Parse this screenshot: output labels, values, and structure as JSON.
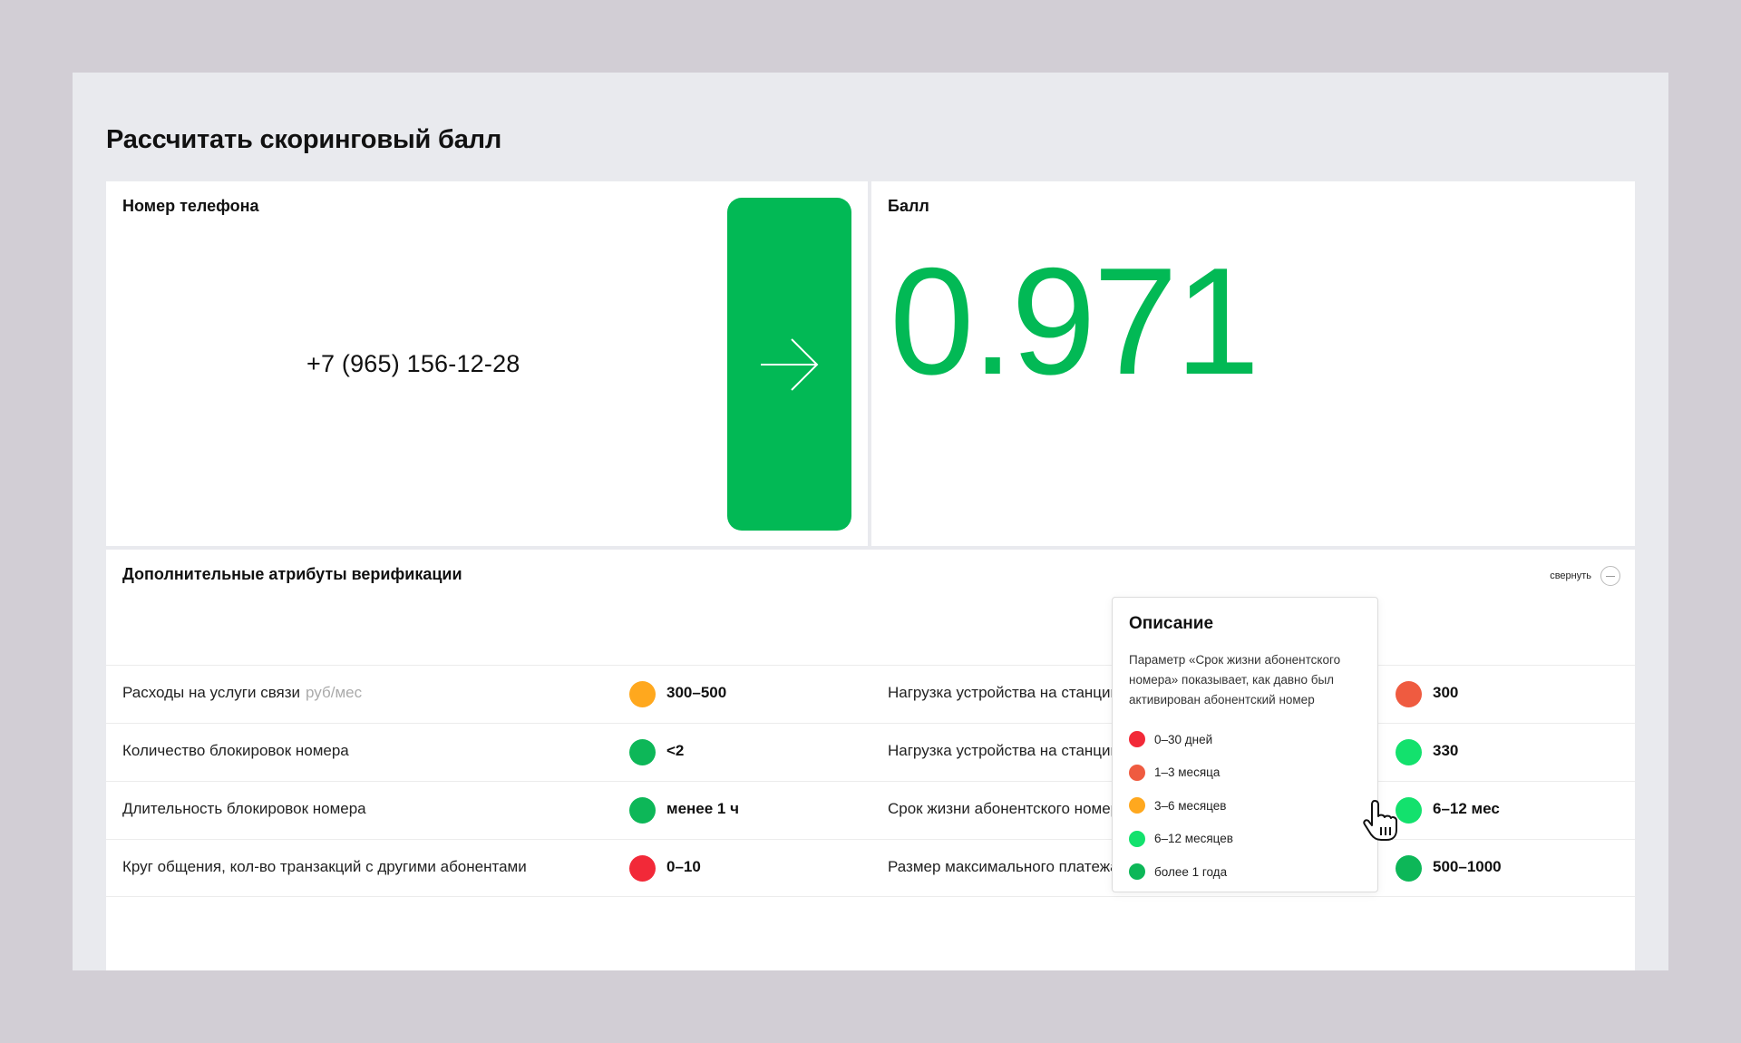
{
  "page": {
    "title": "Рассчитать скоринговый балл"
  },
  "phone_card": {
    "label": "Номер телефона",
    "value": "+7 (965) 156-12-28"
  },
  "score_card": {
    "label": "Балл",
    "value": "0.971"
  },
  "attributes": {
    "title": "Дополнительные атрибуты верификации",
    "collapse_label": "свернуть",
    "left": [
      {
        "label": "Расходы на услуги связи",
        "unit": "руб/мес",
        "value": "300–500",
        "color": "#ffa81e"
      },
      {
        "label": "Количество блокировок номера",
        "unit": "",
        "value": "<2",
        "color": "#0db758"
      },
      {
        "label": "Длительность блокировок номера",
        "unit": "",
        "value": "менее 1 ч",
        "color": "#0db758"
      },
      {
        "label": "Круг общения, кол-во транзакций с другими абонентами",
        "unit": "",
        "value": "0–10",
        "color": "#f22938"
      }
    ],
    "right": [
      {
        "label": "Нагрузка устройства на станции",
        "value": "300",
        "color": "#ef5b40"
      },
      {
        "label": "Нагрузка устройства на станции",
        "value": "330",
        "color": "#13e16d"
      },
      {
        "label": "Срок жизни абонентского номера",
        "value": "6–12 мес",
        "color": "#13e16d"
      },
      {
        "label": "Размер максимального платежа",
        "value": "500–1000",
        "color": "#0db758"
      }
    ]
  },
  "tooltip": {
    "title": "Описание",
    "text": "Параметр «Срок жизни абонентского номера» показывает, как давно был активирован абонентский номер",
    "legend": [
      {
        "label": "0–30 дней",
        "color": "#f22938"
      },
      {
        "label": "1–3 месяца",
        "color": "#ef5b40"
      },
      {
        "label": "3–6 месяцев",
        "color": "#ffa81e"
      },
      {
        "label": "6–12 месяцев",
        "color": "#13e16d"
      },
      {
        "label": "более 1 года",
        "color": "#0db758"
      }
    ]
  },
  "colors": {
    "accent": "#02b955"
  },
  "icons": {
    "go_button": "arrow-right-icon",
    "collapse": "minus-circle-icon",
    "cursor": "hand-pointer-icon"
  }
}
